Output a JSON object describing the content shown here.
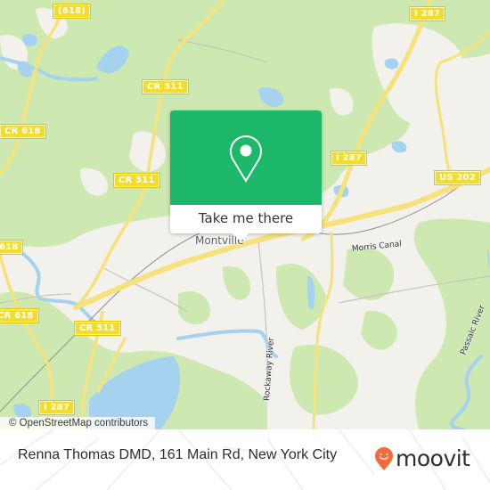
{
  "map": {
    "colors": {
      "background": "#f2f1ec",
      "forest": "#cde8b0",
      "water": "#a5d2ee",
      "road_major": "#f6e27a",
      "road_minor": "#c8c4bc",
      "rail": "#8f8f8f",
      "shield_fill": "#f4dc2a"
    },
    "road_shields": [
      {
        "id": "618-top",
        "label": "(618)"
      },
      {
        "id": "cr511-upper",
        "label": "CR 511"
      },
      {
        "id": "cr618-upper",
        "label": "CR 618"
      },
      {
        "id": "cr511-mid",
        "label": "CR 511"
      },
      {
        "id": "i287-top",
        "label": "I 287"
      },
      {
        "id": "i287-mid",
        "label": "I 287"
      },
      {
        "id": "us202",
        "label": "US 202"
      },
      {
        "id": "618-left",
        "label": "618"
      },
      {
        "id": "cr618-lower",
        "label": "CR 618"
      },
      {
        "id": "cr511-lower",
        "label": "CR 511"
      },
      {
        "id": "i287-bottom",
        "label": "I 287"
      }
    ],
    "place_labels": {
      "town": "Montville"
    },
    "water_labels": {
      "canal": "Morris Canal",
      "river_east": "Passaic River",
      "river_south": "Rockaway River"
    },
    "attribution": "© OpenStreetMap contributors"
  },
  "popup": {
    "icon": "map-pin-icon",
    "button_label": "Take me there",
    "color": "#1db86a"
  },
  "footer": {
    "title": "Renna Thomas DMD, 161 Main Rd, New York City",
    "brand": {
      "name": "moovit",
      "icon": "moovit-pin-smile-icon",
      "color": "#f26b3a"
    }
  }
}
